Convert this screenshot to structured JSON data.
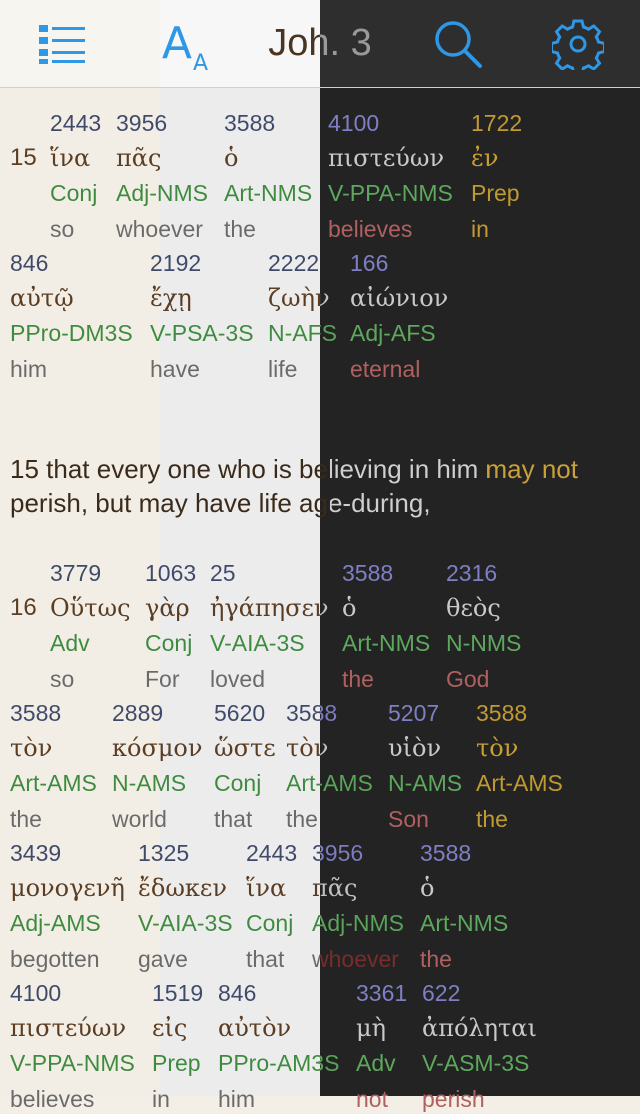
{
  "toolbar": {
    "title": "Joh. 3",
    "font_big": "A",
    "font_small": "A"
  },
  "icons": {
    "list": "list-icon",
    "font": "font-size-icon",
    "search": "search-icon",
    "settings": "gear-icon"
  },
  "colors": {
    "accent": "#2e97e6",
    "sepia_bg": "#f2eee5",
    "dark_bg": "#232323"
  },
  "verse15": {
    "number": "15",
    "row1": [
      {
        "num": "2443",
        "greek": "ἵνα",
        "pos": "Conj",
        "eng": "so"
      },
      {
        "num": "3956",
        "greek": "πᾶς",
        "pos": "Adj-NMS",
        "eng": "whoever"
      },
      {
        "num": "3588",
        "greek": "ὁ",
        "pos": "Art-NMS",
        "eng": "the"
      },
      {
        "num": "4100",
        "greek": "πιστεύων",
        "pos": "V-PPA-NMS",
        "eng": "believes"
      },
      {
        "num": "1722",
        "greek": "ἐν",
        "pos": "Prep",
        "eng": "in"
      }
    ],
    "row2": [
      {
        "num": "846",
        "greek": "αὐτῷ",
        "pos": "PPro-DM3S",
        "eng": "him"
      },
      {
        "num": "2192",
        "greek": "ἔχῃ",
        "pos": "V-PSA-3S",
        "eng": "have"
      },
      {
        "num": "2222",
        "greek": "ζωὴν",
        "pos": "N-AFS",
        "eng": "life"
      },
      {
        "num": "166",
        "greek": "αἰώνιον",
        "pos": "Adj-AFS",
        "eng": "eternal"
      }
    ],
    "translation": "15 that every one who is believing in him may not perish, but may have life age-during,"
  },
  "verse16": {
    "number": "16",
    "row1": [
      {
        "num": "3779",
        "greek": "Οὕτως",
        "pos": "Adv",
        "eng": "so"
      },
      {
        "num": "1063",
        "greek": "γὰρ",
        "pos": "Conj",
        "eng": "For"
      },
      {
        "num": "25",
        "greek": "ἠγάπησεν",
        "pos": "V-AIA-3S",
        "eng": "loved"
      },
      {
        "num": "3588",
        "greek": "ὁ",
        "pos": "Art-NMS",
        "eng": "the"
      },
      {
        "num": "2316",
        "greek": "θεὸς",
        "pos": "N-NMS",
        "eng": "God"
      }
    ],
    "row2": [
      {
        "num": "3588",
        "greek": "τὸν",
        "pos": "Art-AMS",
        "eng": "the"
      },
      {
        "num": "2889",
        "greek": "κόσμον",
        "pos": "N-AMS",
        "eng": "world"
      },
      {
        "num": "5620",
        "greek": "ὥστε",
        "pos": "Conj",
        "eng": "that"
      },
      {
        "num": "3588",
        "greek": "τὸν",
        "pos": "Art-AMS",
        "eng": "the"
      },
      {
        "num": "5207",
        "greek": "υἱὸν",
        "pos": "N-AMS",
        "eng": "Son"
      },
      {
        "num": "3588",
        "greek": "τὸν",
        "pos": "Art-AMS",
        "eng": "the"
      }
    ],
    "row3": [
      {
        "num": "3439",
        "greek": "μονογενῆ",
        "pos": "Adj-AMS",
        "eng": "begotten"
      },
      {
        "num": "1325",
        "greek": "ἔδωκεν",
        "pos": "V-AIA-3S",
        "eng": "gave"
      },
      {
        "num": "2443",
        "greek": "ἵνα",
        "pos": "Conj",
        "eng": "that"
      },
      {
        "num": "3956",
        "greek": "πᾶς",
        "pos": "Adj-NMS",
        "eng": "whoever"
      },
      {
        "num": "3588",
        "greek": "ὁ",
        "pos": "Art-NMS",
        "eng": "the"
      }
    ],
    "row4": [
      {
        "num": "4100",
        "greek": "πιστεύων",
        "pos": "V-PPA-NMS",
        "eng": "believes"
      },
      {
        "num": "1519",
        "greek": "εἰς",
        "pos": "Prep",
        "eng": "in"
      },
      {
        "num": "846",
        "greek": "αὐτὸν",
        "pos": "PPro-AM3S",
        "eng": "him"
      },
      {
        "num": "3361",
        "greek": "μὴ",
        "pos": "Adv",
        "eng": "not"
      },
      {
        "num": "622",
        "greek": "ἀπόληται",
        "pos": "V-ASM-3S",
        "eng": "perish"
      }
    ]
  }
}
